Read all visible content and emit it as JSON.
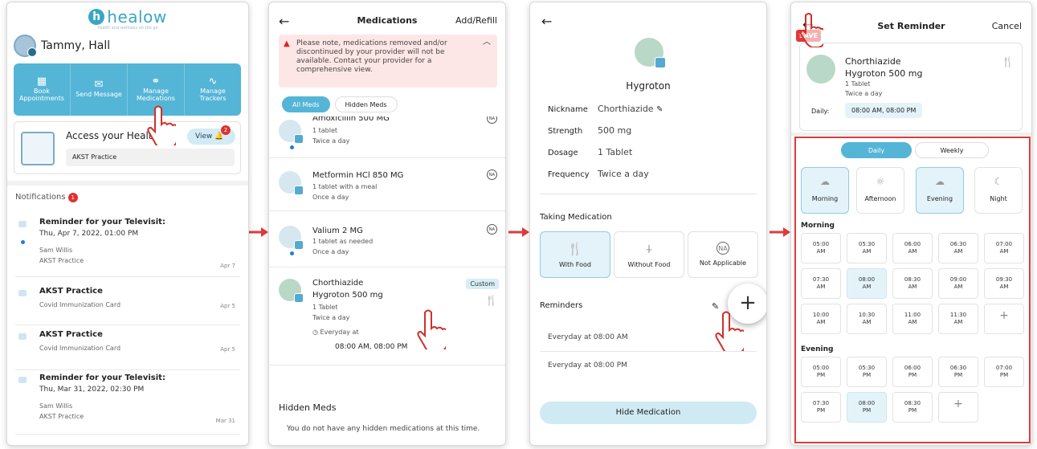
{
  "colors": {
    "accent": "#54b5d6",
    "arrow": "#e03a3a",
    "badge": "#e03030"
  },
  "screen1": {
    "logo": "healow",
    "logo_tagline": "health and wellness on the go",
    "user": "Tammy, Hall",
    "quick": [
      {
        "icon": "calendar-icon",
        "label": "Book\nAppointments"
      },
      {
        "icon": "envelope-icon",
        "label": "Send Message"
      },
      {
        "icon": "pill-icon",
        "label": "Manage\nMedications"
      },
      {
        "icon": "pulse-icon",
        "label": "Manage\nTrackers"
      }
    ],
    "health_title_a": "Access your Health",
    "health_title_b": "ds",
    "view": "View",
    "view_badge": "2",
    "practice": "AKST Practice",
    "notifications_label": "Notifications",
    "notifications_badge": "1",
    "notifications": [
      {
        "title": "Reminder for your Televisit:",
        "line1": "Thu, Apr 7, 2022, 01:00 PM",
        "line2": "Sam Willis",
        "line3": "AKST Practice",
        "date": "Apr 7"
      },
      {
        "title": "AKST Practice",
        "line1": "Covid Immunization Card",
        "date": "Apr 5"
      },
      {
        "title": "AKST Practice",
        "line1": "Covid Immunization Card",
        "date": "Apr 5"
      },
      {
        "title": "Reminder for your Televisit:",
        "line1": "Thu, Mar 31, 2022, 02:30 PM",
        "line2": "Sam Willis",
        "line3": "AKST Practice",
        "date": "Mar 31"
      }
    ]
  },
  "screen2": {
    "back": "←",
    "title": "Medications",
    "add": "Add/Refill",
    "warning": "Please note, medications removed and/or discontinued by your provider will not be available. Contact your provider for a comprehensive view.",
    "tab_all": "All Meds",
    "tab_hidden": "Hidden Meds",
    "meds": [
      {
        "name": "Amoxicillin 500 MG",
        "l1": "1 tablet",
        "l2": "Twice a day",
        "tag": "NA"
      },
      {
        "name": "Metformin HCl 850 MG",
        "l1": "1 tablet with a meal",
        "l2": "Once a day",
        "tag": "NA"
      },
      {
        "name": "Valium 2 MG",
        "l1": "1 tablet as needed",
        "l2": "Once a day",
        "tag": "NA"
      }
    ],
    "custom_med": {
      "name": "Chorthiazide",
      "brand": "Hygroton 500 mg",
      "l1": "1 Tablet",
      "l2": "Twice a day",
      "everyday": "Everyday at",
      "times": "08:00 AM, 08:00 PM",
      "tag": "Custom"
    },
    "hidden_title": "Hidden Meds",
    "hidden_empty": "You do not have any hidden medications at this time."
  },
  "screen3": {
    "back": "←",
    "title": "Hygroton",
    "rows": [
      {
        "k": "Nickname",
        "v": "Chorthiazide"
      },
      {
        "k": "Strength",
        "v": "500 mg"
      },
      {
        "k": "Dosage",
        "v": "1 Tablet"
      },
      {
        "k": "Frequency",
        "v": "Twice a day"
      }
    ],
    "taking": "Taking Medication",
    "options": [
      {
        "icon": "fork-knife-icon",
        "label": "With Food",
        "selected": true
      },
      {
        "icon": "no-food-icon",
        "label": "Without Food",
        "selected": false
      },
      {
        "icon": "na-icon",
        "label": "Not Applicable",
        "selected": false
      }
    ],
    "na_glyph": "NA",
    "reminders": "Reminders",
    "reminder_list": [
      "Everyday at 08:00 AM",
      "Everyday at 08:00 PM"
    ],
    "hide_btn": "Hide Medication",
    "plus": "+"
  },
  "screen4": {
    "back": "←",
    "save": "SAVE",
    "title": "Set Reminder",
    "cancel": "Cancel",
    "med_name": "Chorthiazide",
    "med_brand": "Hygroton 500 mg",
    "med_l1": "1 Tablet",
    "med_l2": "Twice a day",
    "daily_label": "Daily:",
    "daily_value": "08:00 AM, 08:00 PM",
    "seg_daily": "Daily",
    "seg_weekly": "Weekly",
    "tod": [
      {
        "icon": "cloud-sun-icon",
        "label": "Morning",
        "on": true
      },
      {
        "icon": "sun-icon",
        "label": "Afternoon",
        "on": false
      },
      {
        "icon": "cloud-evening-icon",
        "label": "Evening",
        "on": true
      },
      {
        "icon": "moon-icon",
        "label": "Night",
        "on": false
      }
    ],
    "morning_label": "Morning",
    "morning": [
      {
        "t": "05:00",
        "p": "AM"
      },
      {
        "t": "05:30",
        "p": "AM"
      },
      {
        "t": "06:00",
        "p": "AM"
      },
      {
        "t": "06:30",
        "p": "AM"
      },
      {
        "t": "07:00",
        "p": "AM"
      },
      {
        "t": "07:30",
        "p": "AM"
      },
      {
        "t": "08:00",
        "p": "AM",
        "on": true
      },
      {
        "t": "08:30",
        "p": "AM"
      },
      {
        "t": "09:00",
        "p": "AM"
      },
      {
        "t": "09:30",
        "p": "AM"
      },
      {
        "t": "10:00",
        "p": "AM"
      },
      {
        "t": "10:30",
        "p": "AM"
      },
      {
        "t": "11:00",
        "p": "AM"
      },
      {
        "t": "11:30",
        "p": "AM"
      },
      {
        "t": "+",
        "p": ""
      }
    ],
    "evening_label": "Evening",
    "evening": [
      {
        "t": "05:00",
        "p": "PM"
      },
      {
        "t": "05:30",
        "p": "PM"
      },
      {
        "t": "06:00",
        "p": "PM"
      },
      {
        "t": "06:30",
        "p": "PM"
      },
      {
        "t": "07:00",
        "p": "PM"
      },
      {
        "t": "07:30",
        "p": "PM"
      },
      {
        "t": "08:00",
        "p": "PM",
        "on": true
      },
      {
        "t": "08:30",
        "p": "PM"
      },
      {
        "t": "+",
        "p": ""
      }
    ]
  }
}
